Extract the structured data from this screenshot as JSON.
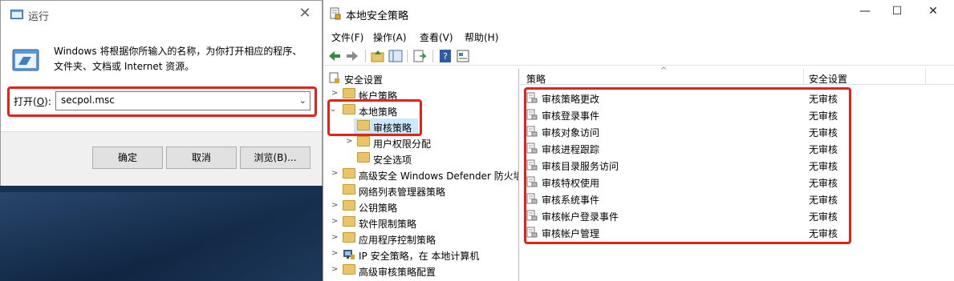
{
  "run_dialog": {
    "title": "运行",
    "description": "Windows 将根据你所输入的名称，为你打开相应的程序、文件夹、文档或 Internet 资源。",
    "open_label_prefix": "打开(",
    "open_label_key": "O",
    "open_label_suffix": "):",
    "open_value": "secpol.msc",
    "buttons": {
      "ok": "确定",
      "cancel": "取消",
      "browse": "浏览(B)..."
    }
  },
  "lsp_window": {
    "title": "本地安全策略",
    "menu": [
      "文件(F)",
      "操作(A)",
      "查看(V)",
      "帮助(H)"
    ],
    "tree": [
      {
        "label": "安全设置",
        "level": 0,
        "expanded": true
      },
      {
        "label": "帐户策略",
        "level": 1,
        "expandable": true
      },
      {
        "label": "本地策略",
        "level": 1,
        "expanded": true
      },
      {
        "label": "审核策略",
        "level": 2,
        "selected": true
      },
      {
        "label": "用户权限分配",
        "level": 2,
        "expandable": true
      },
      {
        "label": "安全选项",
        "level": 2
      },
      {
        "label": "高级安全 Windows Defender 防火墙",
        "level": 1,
        "expandable": true
      },
      {
        "label": "网络列表管理器策略",
        "level": 1
      },
      {
        "label": "公钥策略",
        "level": 1,
        "expandable": true
      },
      {
        "label": "软件限制策略",
        "level": 1,
        "expandable": true
      },
      {
        "label": "应用程序控制策略",
        "level": 1,
        "expandable": true
      },
      {
        "label": "IP 安全策略，在 本地计算机",
        "level": 1,
        "expandable": true
      },
      {
        "label": "高级审核策略配置",
        "level": 1,
        "expandable": true
      }
    ],
    "columns": {
      "policy": "策略",
      "setting": "安全设置"
    },
    "rows": [
      {
        "policy": "审核策略更改",
        "setting": "无审核"
      },
      {
        "policy": "审核登录事件",
        "setting": "无审核"
      },
      {
        "policy": "审核对象访问",
        "setting": "无审核"
      },
      {
        "policy": "审核进程跟踪",
        "setting": "无审核"
      },
      {
        "policy": "审核目录服务访问",
        "setting": "无审核"
      },
      {
        "policy": "审核特权使用",
        "setting": "无审核"
      },
      {
        "policy": "审核系统事件",
        "setting": "无审核"
      },
      {
        "policy": "审核帐户登录事件",
        "setting": "无审核"
      },
      {
        "policy": "审核帐户管理",
        "setting": "无审核"
      }
    ]
  },
  "colors": {
    "highlight_red": "#e2231a",
    "selection_blue": "#cce8ff"
  }
}
